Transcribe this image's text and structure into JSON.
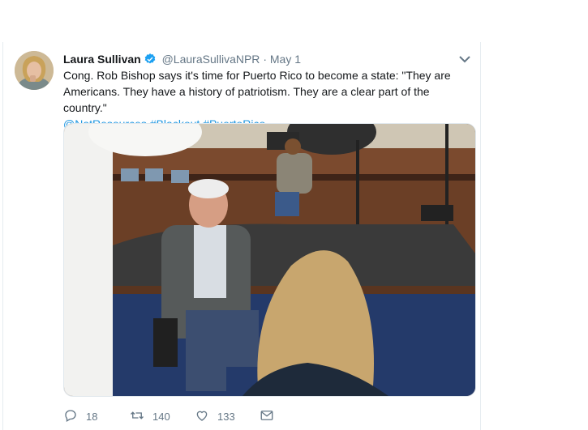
{
  "tweet": {
    "display_name": "Laura Sullivan",
    "handle": "@LauraSullivaNPR",
    "separator": "·",
    "date": "May 1",
    "text": "Cong. Rob Bishop says it's time for Puerto Rico to become a state: \"They are Americans. They have a history of patriotism. They are a clear part of the country.\"",
    "hashtags": [
      "@NatResources",
      "#Blackout",
      "#PuertoRico"
    ],
    "actions": {
      "reply_count": "18",
      "retweet_count": "140",
      "like_count": "133"
    }
  },
  "icons": {
    "verified": "verified-badge-icon",
    "caret": "chevron-down-icon",
    "reply": "reply-icon",
    "retweet": "retweet-icon",
    "like": "heart-icon",
    "dm": "envelope-icon"
  },
  "colors": {
    "link": "#1b95e0",
    "muted": "#657786",
    "text": "#14171a",
    "verified": "#1da1f2"
  }
}
